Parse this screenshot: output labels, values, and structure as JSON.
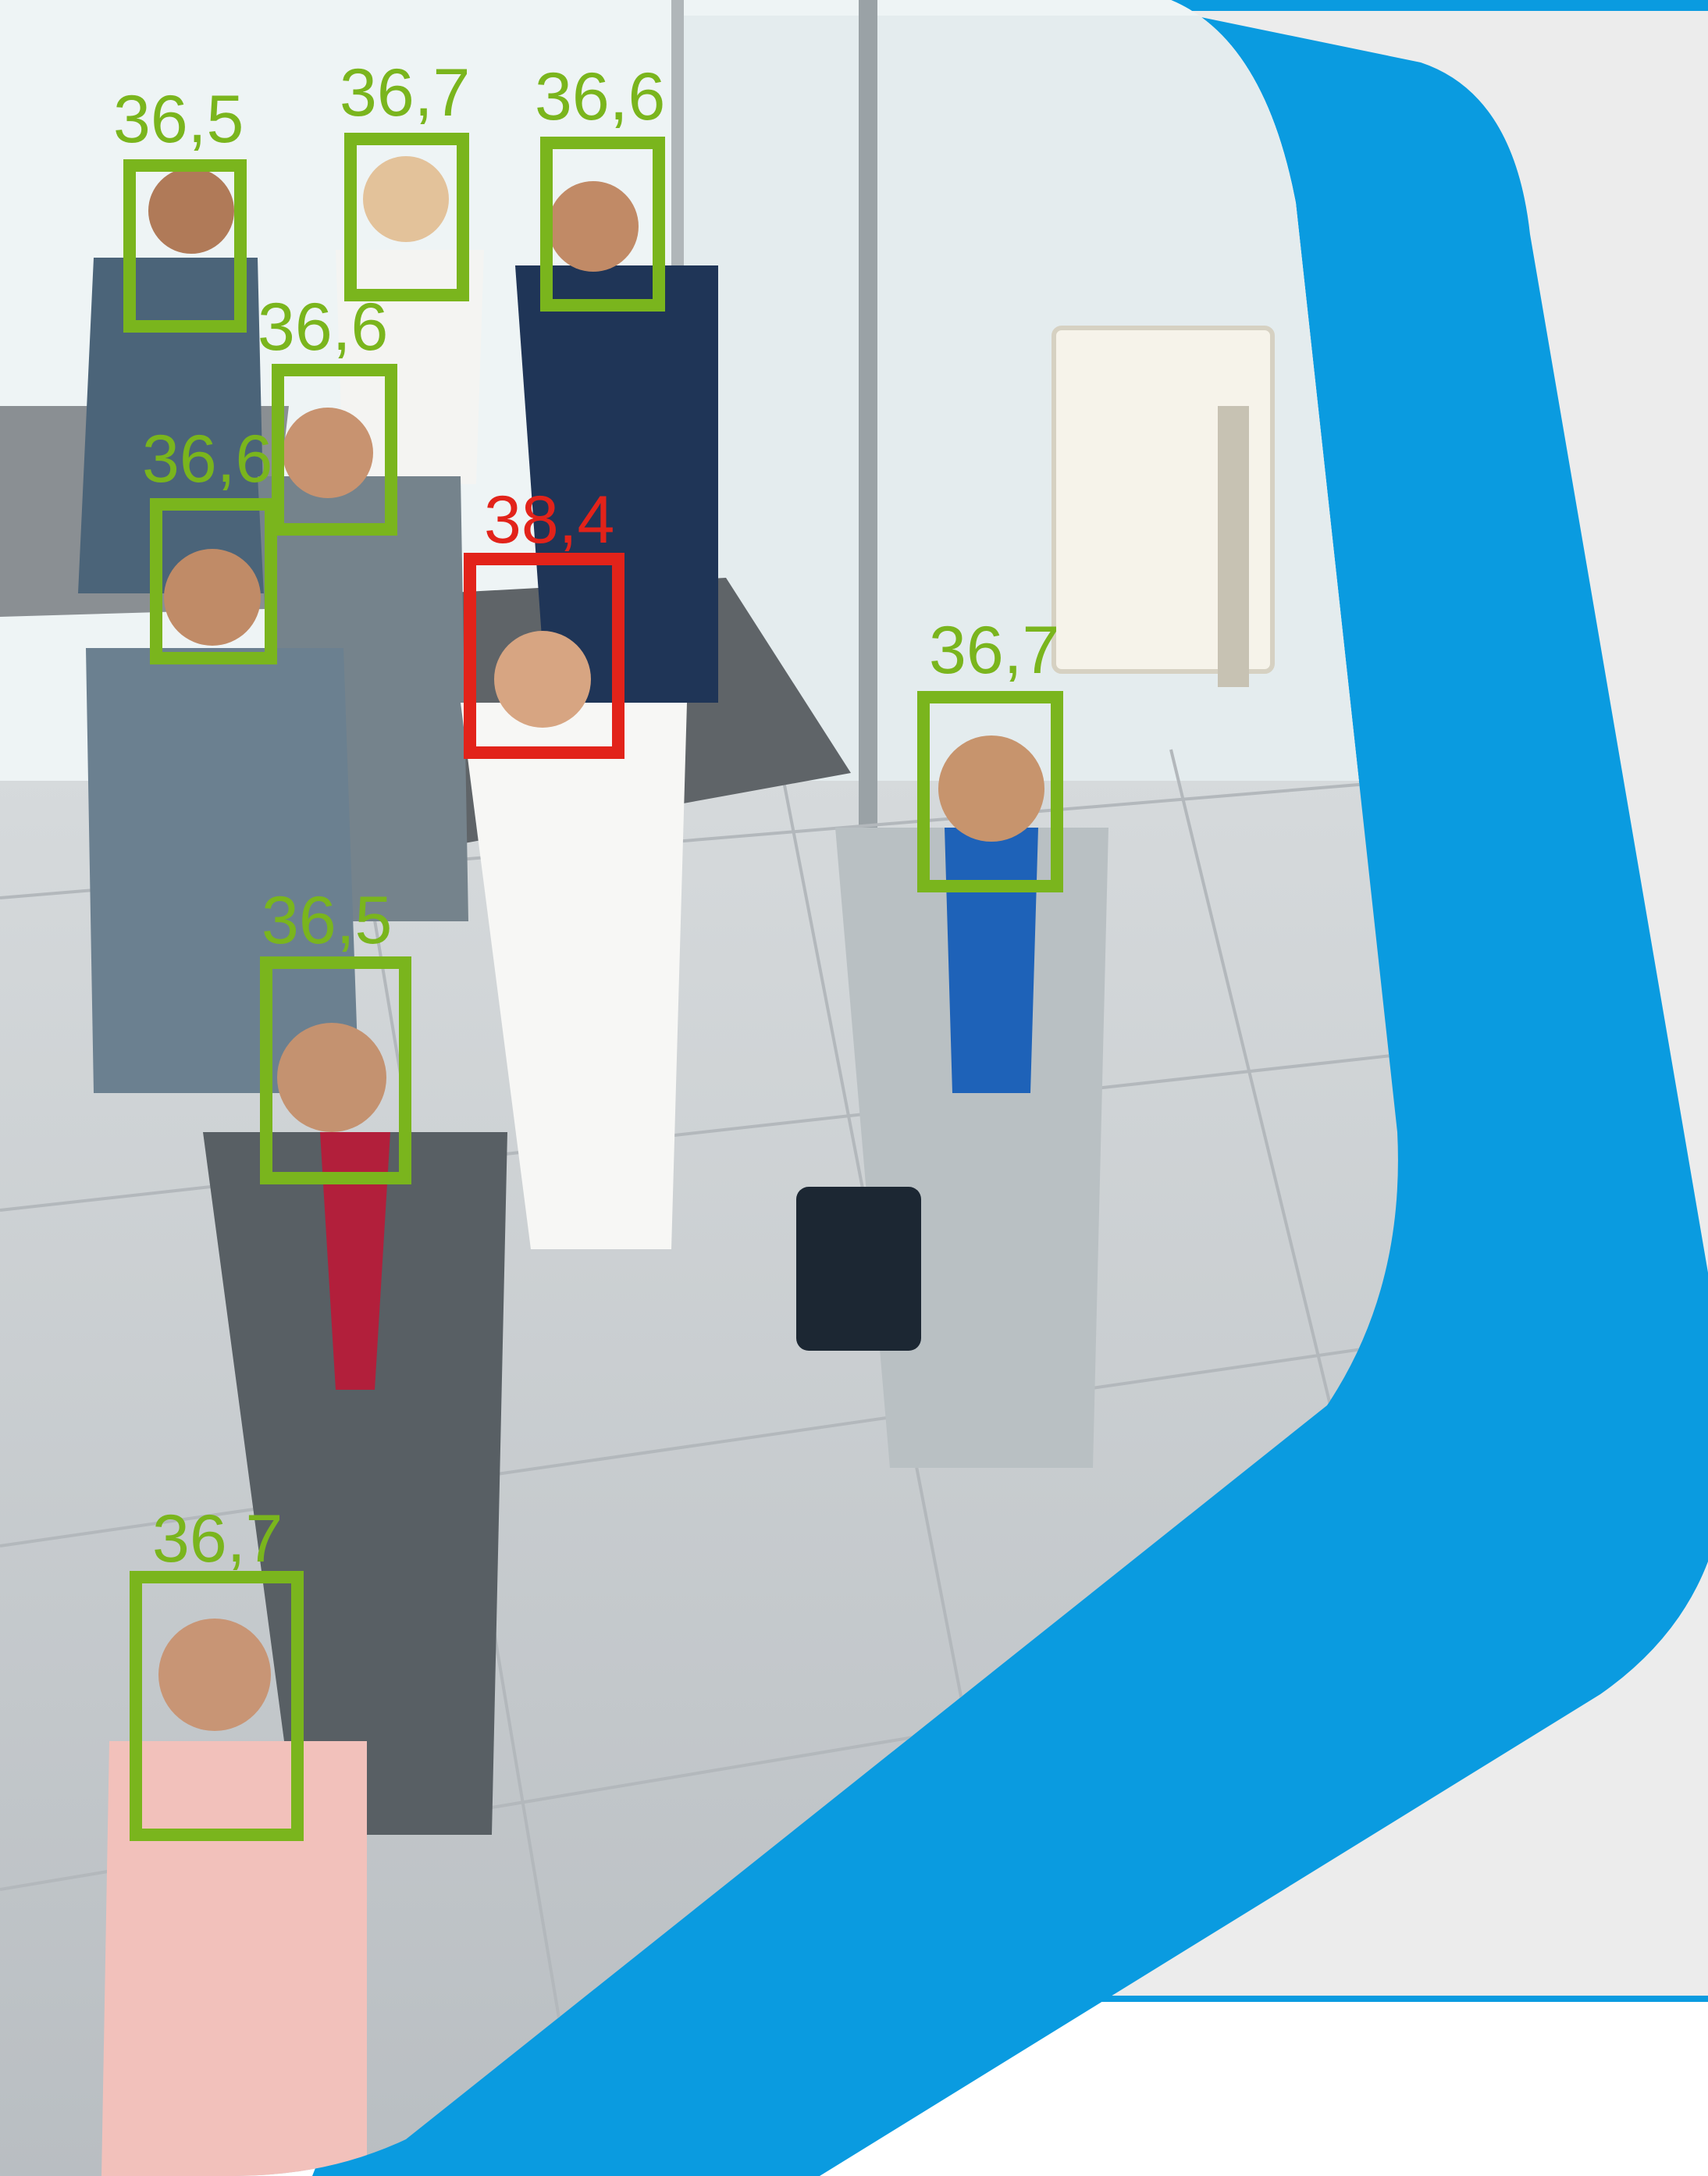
{
  "colors": {
    "brand_blue": "#0a9be0",
    "panel_gray": "#ececec",
    "normal": "#7ab51d",
    "alert": "#e2231a",
    "floor": "#c9cdd0",
    "glass": "#e9f0f2"
  },
  "detections": [
    {
      "temperature": "36,5",
      "status": "normal"
    },
    {
      "temperature": "36,7",
      "status": "normal"
    },
    {
      "temperature": "36,6",
      "status": "normal"
    },
    {
      "temperature": "36,6",
      "status": "normal"
    },
    {
      "temperature": "36,6",
      "status": "normal"
    },
    {
      "temperature": "38,4",
      "status": "alert"
    },
    {
      "temperature": "36,7",
      "status": "normal"
    },
    {
      "temperature": "36,5",
      "status": "normal"
    },
    {
      "temperature": "36,7",
      "status": "normal"
    }
  ]
}
